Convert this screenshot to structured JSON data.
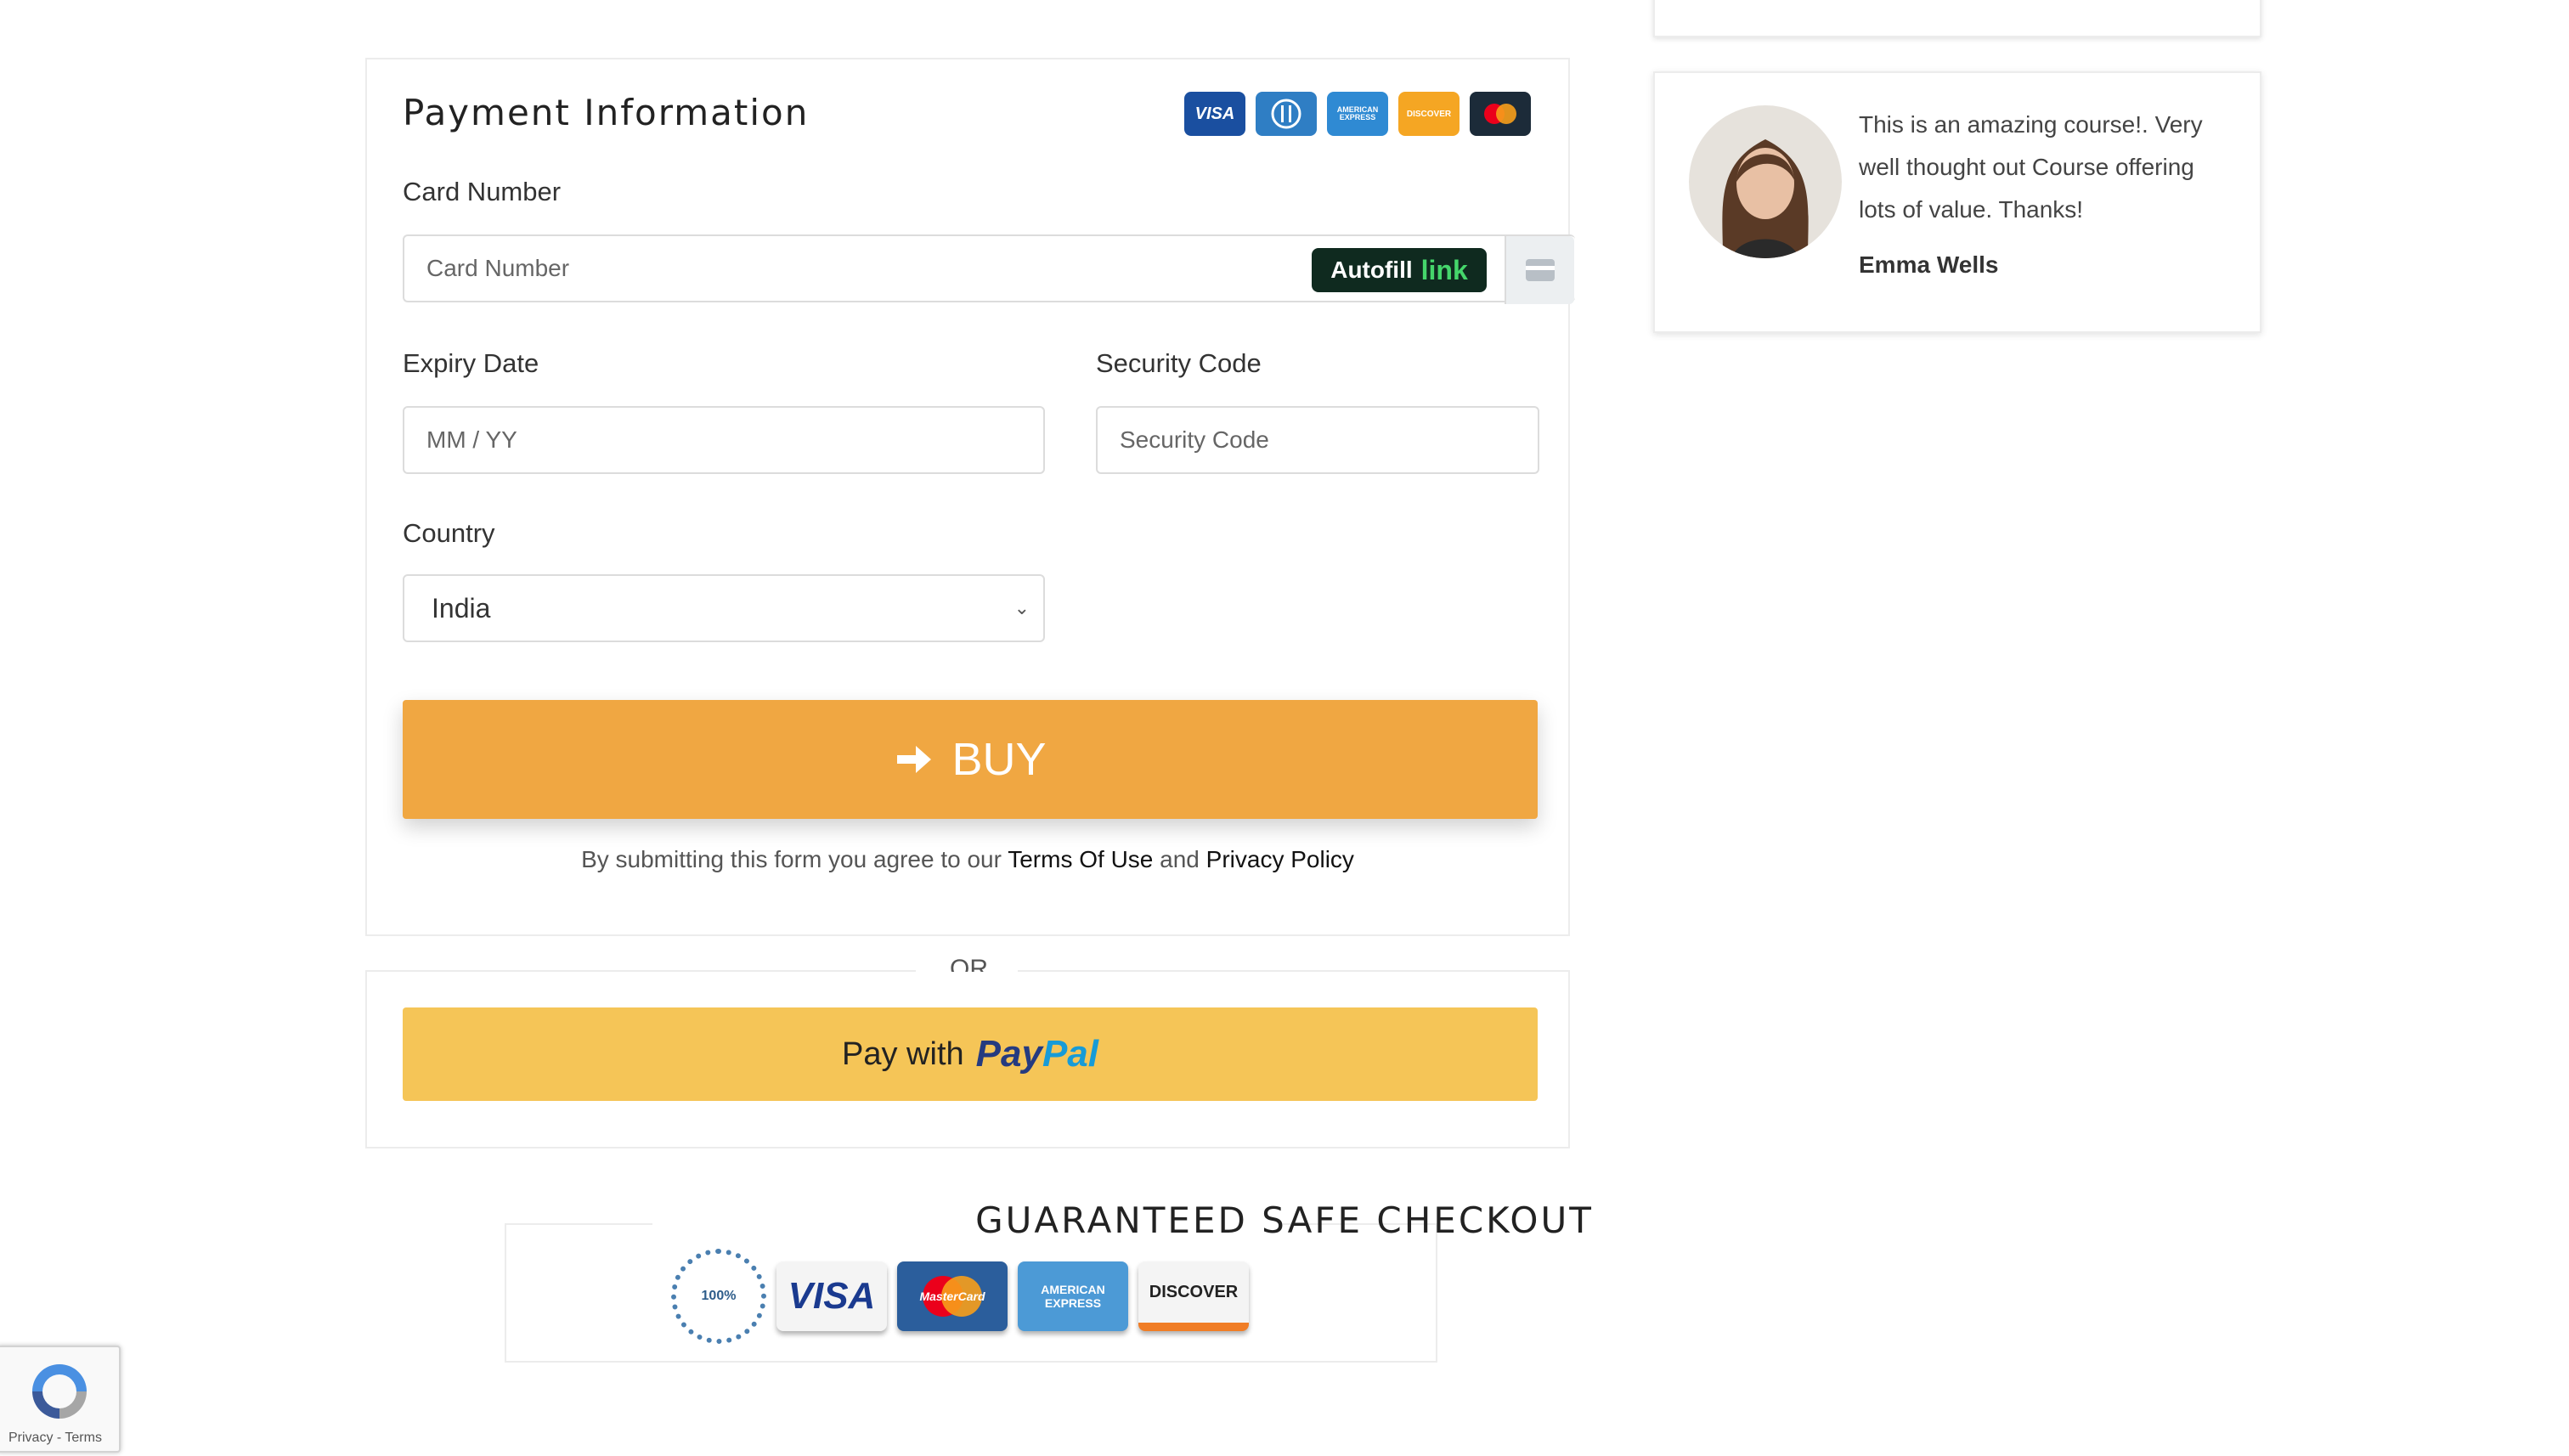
{
  "payment": {
    "title": "Payment Information",
    "card_logos": [
      "VISA",
      "DINERS",
      "AMERICAN EXPRESS",
      "DISCOVER",
      "MASTERCARD"
    ],
    "card_number_label": "Card Number",
    "card_number_placeholder": "Card Number",
    "autofill_label": "Autofill",
    "autofill_link": "link",
    "expiry_label": "Expiry Date",
    "expiry_placeholder": "MM / YY",
    "security_label": "Security Code",
    "security_placeholder": "Security Code",
    "country_label": "Country",
    "country_value": "India",
    "buy_label": "BUY",
    "agree_prefix": "By submitting this form you agree to our ",
    "terms_link": "Terms Of Use",
    "agree_and": " and ",
    "privacy_link": "Privacy Policy"
  },
  "or_text": "OR",
  "paypal": {
    "prefix": "Pay with",
    "brand_part1": "Pay",
    "brand_part2": "Pal"
  },
  "safe_checkout": {
    "title": "GUARANTEED SAFE CHECKOUT",
    "seal_text": "100%",
    "visa": "VISA",
    "mastercard": "MasterCard",
    "amex_line1": "AMERICAN",
    "amex_line2": "EXPRESS",
    "discover": "DISCOVER"
  },
  "testimonial": {
    "quote": "This is an amazing course!. Very well thought out Course offering lots of value. Thanks!",
    "author": "Emma Wells"
  },
  "recaptcha": {
    "links": "Privacy - Terms"
  },
  "colors": {
    "buy_button": "#f0a742",
    "paypal_button": "#f5c557",
    "autofill_bg": "#0f2a1f",
    "link_green": "#45d66b"
  }
}
